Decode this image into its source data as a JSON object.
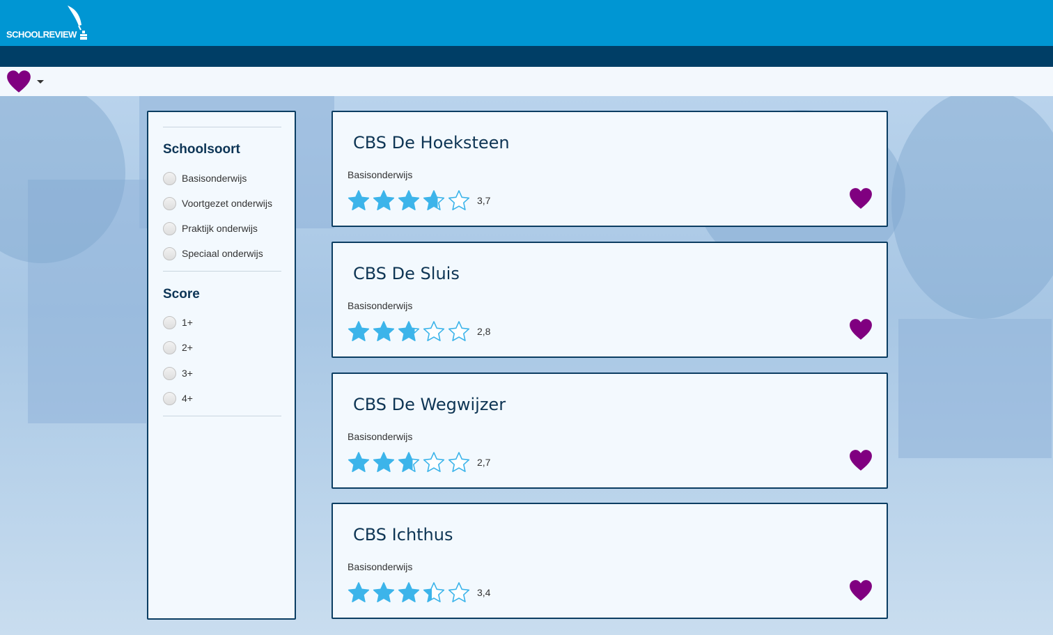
{
  "header": {
    "logo_text": "SCHOOLREVIEW",
    "brand_color": "#0096d3",
    "nav_color": "#003e66"
  },
  "favorites_menu": {
    "icon": "heart-icon",
    "color": "#800080"
  },
  "filters": {
    "schoolsoort": {
      "heading": "Schoolsoort",
      "options": [
        "Basisonderwijs",
        "Voortgezet onderwijs",
        "Praktijk onderwijs",
        "Speciaal onderwijs"
      ]
    },
    "score": {
      "heading": "Score",
      "options": [
        "1+",
        "2+",
        "3+",
        "4+"
      ]
    }
  },
  "schools": [
    {
      "name": "CBS De Hoeksteen",
      "type": "Basisonderwijs",
      "score_text": "3,7",
      "rating": 3.7
    },
    {
      "name": "CBS De Sluis",
      "type": "Basisonderwijs",
      "score_text": "2,8",
      "rating": 2.8
    },
    {
      "name": "CBS De Wegwijzer",
      "type": "Basisonderwijs",
      "score_text": "2,7",
      "rating": 2.7
    },
    {
      "name": "CBS Ichthus",
      "type": "Basisonderwijs",
      "score_text": "3,4",
      "rating": 3.4
    }
  ],
  "colors": {
    "star": "#3cb4ea",
    "heart": "#800080",
    "card_border": "#0b3d62"
  }
}
